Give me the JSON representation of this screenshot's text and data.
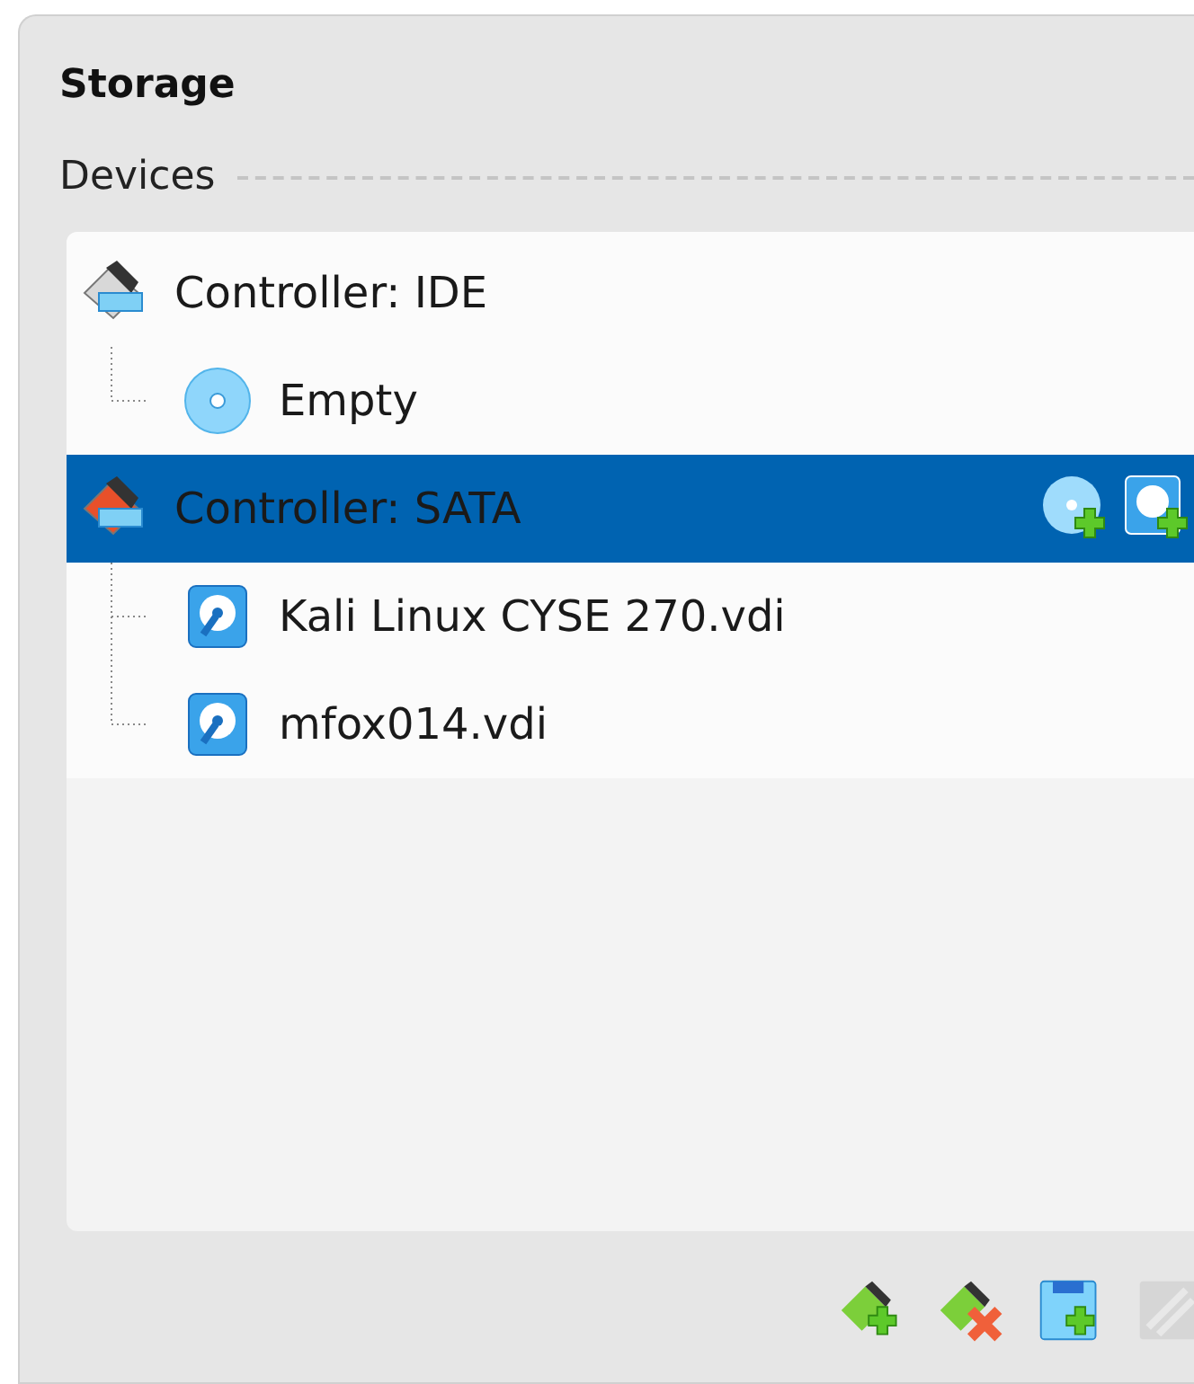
{
  "title": "Storage",
  "section": "Devices",
  "tree": [
    {
      "label": "Controller: IDE",
      "kind": "ide",
      "selected": false,
      "children": [
        {
          "label": "Empty",
          "kind": "optical",
          "selected": false
        }
      ]
    },
    {
      "label": "Controller: SATA",
      "kind": "sata",
      "selected": true,
      "children": [
        {
          "label": "Kali Linux CYSE 270.vdi",
          "kind": "hdd",
          "selected": false
        },
        {
          "label": "mfox014.vdi",
          "kind": "hdd",
          "selected": false
        }
      ]
    }
  ],
  "toolbar": [
    {
      "kind": "add-controller",
      "disabled": false
    },
    {
      "kind": "remove-controller",
      "disabled": false
    },
    {
      "kind": "add-attachment",
      "disabled": false
    },
    {
      "kind": "remove-attachment",
      "disabled": true
    }
  ]
}
